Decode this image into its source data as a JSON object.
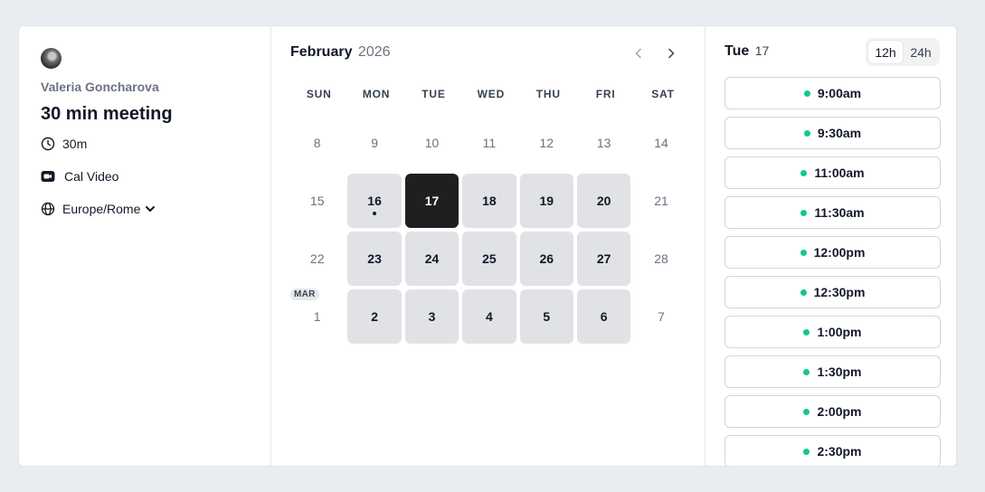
{
  "host": {
    "name": "Valeria Goncharova"
  },
  "event": {
    "title": "30 min meeting",
    "duration": "30m",
    "location": "Cal Video",
    "timezone": "Europe/Rome"
  },
  "calendar": {
    "month": "February",
    "year": "2026",
    "weekdays": [
      "SUN",
      "MON",
      "TUE",
      "WED",
      "THU",
      "FRI",
      "SAT"
    ],
    "next_month_badge": "MAR",
    "weeks": [
      [
        {
          "d": "8",
          "avail": false
        },
        {
          "d": "9",
          "avail": false
        },
        {
          "d": "10",
          "avail": false
        },
        {
          "d": "11",
          "avail": false
        },
        {
          "d": "12",
          "avail": false
        },
        {
          "d": "13",
          "avail": false
        },
        {
          "d": "14",
          "avail": false
        }
      ],
      [
        {
          "d": "15",
          "avail": false
        },
        {
          "d": "16",
          "avail": true,
          "today": true
        },
        {
          "d": "17",
          "avail": true,
          "selected": true
        },
        {
          "d": "18",
          "avail": true
        },
        {
          "d": "19",
          "avail": true
        },
        {
          "d": "20",
          "avail": true
        },
        {
          "d": "21",
          "avail": false
        }
      ],
      [
        {
          "d": "22",
          "avail": false
        },
        {
          "d": "23",
          "avail": true
        },
        {
          "d": "24",
          "avail": true
        },
        {
          "d": "25",
          "avail": true
        },
        {
          "d": "26",
          "avail": true
        },
        {
          "d": "27",
          "avail": true
        },
        {
          "d": "28",
          "avail": false
        }
      ],
      [
        {
          "d": "1",
          "avail": false,
          "badge": true
        },
        {
          "d": "2",
          "avail": true
        },
        {
          "d": "3",
          "avail": true
        },
        {
          "d": "4",
          "avail": true
        },
        {
          "d": "5",
          "avail": true
        },
        {
          "d": "6",
          "avail": true
        },
        {
          "d": "7",
          "avail": false
        }
      ]
    ]
  },
  "slots": {
    "day_label": "Tue",
    "date_label": "17",
    "format_12h": "12h",
    "format_24h": "24h",
    "active_format": "12h",
    "times": [
      "9:00am",
      "9:30am",
      "11:00am",
      "11:30am",
      "12:00pm",
      "12:30pm",
      "1:00pm",
      "1:30pm",
      "2:00pm",
      "2:30pm"
    ],
    "available_color": "#10c98a"
  },
  "colors": {
    "background": "#e9ecf0",
    "available_day": "#e1e2e6",
    "selected_day": "#1f1f1f"
  }
}
